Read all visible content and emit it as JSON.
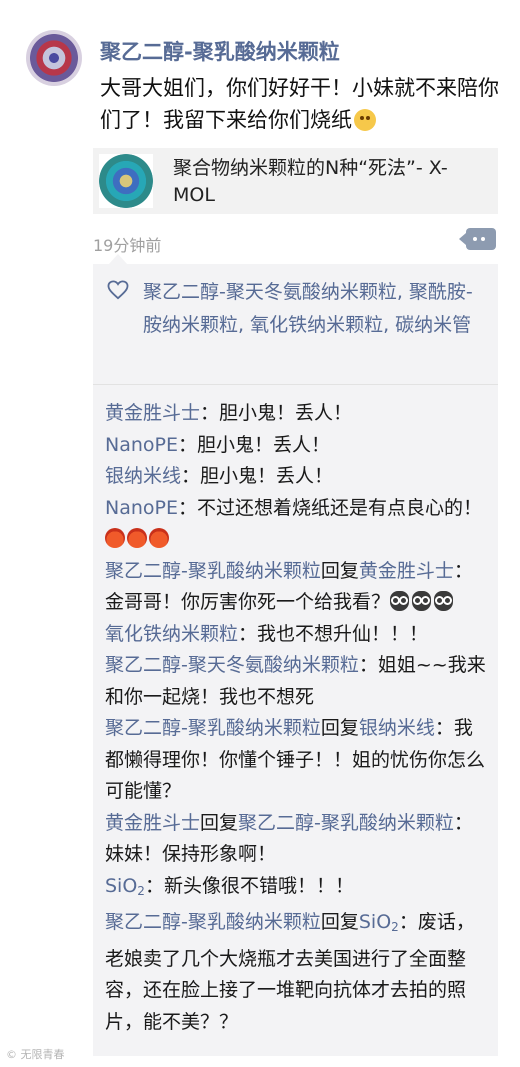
{
  "post": {
    "author": "聚乙二醇-聚乳酸纳米颗粒",
    "text": "大哥大姐们，你们好好干！小妹就不来陪你们了！我留下来给你们烧纸",
    "emoji": "worried-face-emoji",
    "link": {
      "title": "聚合物纳米颗粒的N种“死法”- X-MOL",
      "thumbnail": "nanoparticle-thumbnail"
    },
    "time": "19分钟前"
  },
  "likes": {
    "icon": "heart-icon",
    "names": "聚乙二醇-聚天冬氨酸纳米颗粒, 聚酰胺-胺纳米颗粒, 氧化铁纳米颗粒, 碳纳米管"
  },
  "comments": [
    {
      "name": "黄金胜斗士",
      "text": "：胆小鬼！丢人！"
    },
    {
      "name": "NanoPE",
      "text": "：胆小鬼！丢人！"
    },
    {
      "name": "银纳米线",
      "text": "：胆小鬼！丢人！"
    },
    {
      "name": "NanoPE",
      "text": "：不过还想着烧纸还是有点良心的！",
      "emoji": "angry-face-emoji",
      "emoji_count": 3
    },
    {
      "name": "聚乙二醇-聚乳酸纳米颗粒",
      "reply_word": "回复",
      "reply_to": "黄金胜斗士",
      "text": "：金哥哥！你厉害你死一个给我看？",
      "emoji": "owl-emoji",
      "emoji_count": 3
    },
    {
      "name": "氧化铁纳米颗粒",
      "text": "：我也不想升仙！！！"
    },
    {
      "name": "聚乙二醇-聚天冬氨酸纳米颗粒",
      "text": "：姐姐~~我来和你一起烧！我也不想死"
    },
    {
      "name": "聚乙二醇-聚乳酸纳米颗粒",
      "reply_word": "回复",
      "reply_to": "银纳米线",
      "text": "：我都懒得理你！你懂个锤子！！姐的忧伤你怎么可能懂？"
    },
    {
      "name": "黄金胜斗士",
      "reply_word": "回复",
      "reply_to": "聚乙二醇-聚乳酸纳米颗粒",
      "text": "：妹妹！保持形象啊！"
    },
    {
      "name_main": "SiO",
      "name_sub": "2",
      "text": "：新头像很不错哦！！！"
    },
    {
      "name": "聚乙二醇-聚乳酸纳米颗粒",
      "reply_word": "回复",
      "reply_to_main": "SiO",
      "reply_to_sub": "2",
      "text": "：废话，老娘卖了几个大烧瓶才去美国进行了全面整容，还在脸上接了一堆靶向抗体才去拍的照片，能不美？？"
    }
  ],
  "watermark": "©   无限青春"
}
